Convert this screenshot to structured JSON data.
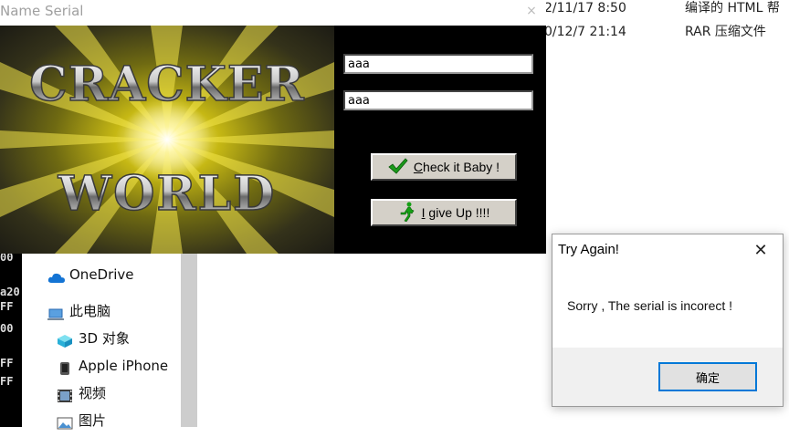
{
  "background": {
    "files": [
      {
        "date": "2/11/17 8:50",
        "type": "编译的 HTML 帮"
      },
      {
        "date": "0/12/7 21:14",
        "type": "RAR 压缩文件"
      }
    ],
    "console_lines": [
      "00",
      "a20",
      "FF",
      "00",
      "FF",
      "FF"
    ],
    "nav_items": [
      {
        "label": "OneDrive",
        "icon": "cloud-icon"
      },
      {
        "label": "此电脑",
        "icon": "computer-icon"
      },
      {
        "label": "3D 对象",
        "icon": "cube-icon"
      },
      {
        "label": "Apple iPhone",
        "icon": "phone-icon"
      },
      {
        "label": "视频",
        "icon": "video-icon"
      },
      {
        "label": "图片",
        "icon": "picture-icon"
      }
    ]
  },
  "crackme": {
    "title": "Name Serial",
    "close_glyph": "×",
    "banner_line1": "CRACKER",
    "banner_line2": "WORLD",
    "name_value": "aaa",
    "serial_value": "aaa",
    "check_label": "Check it Baby !",
    "giveup_label": "I give Up !!!!",
    "colors": {
      "check_icon": "#1a9a1a",
      "giveup_icon": "#14a014"
    }
  },
  "msgbox": {
    "title": "Try Again!",
    "close_glyph": "✕",
    "message": "Sorry , The serial is incorect !",
    "ok_label": "确定",
    "accent": "#0078d7"
  }
}
